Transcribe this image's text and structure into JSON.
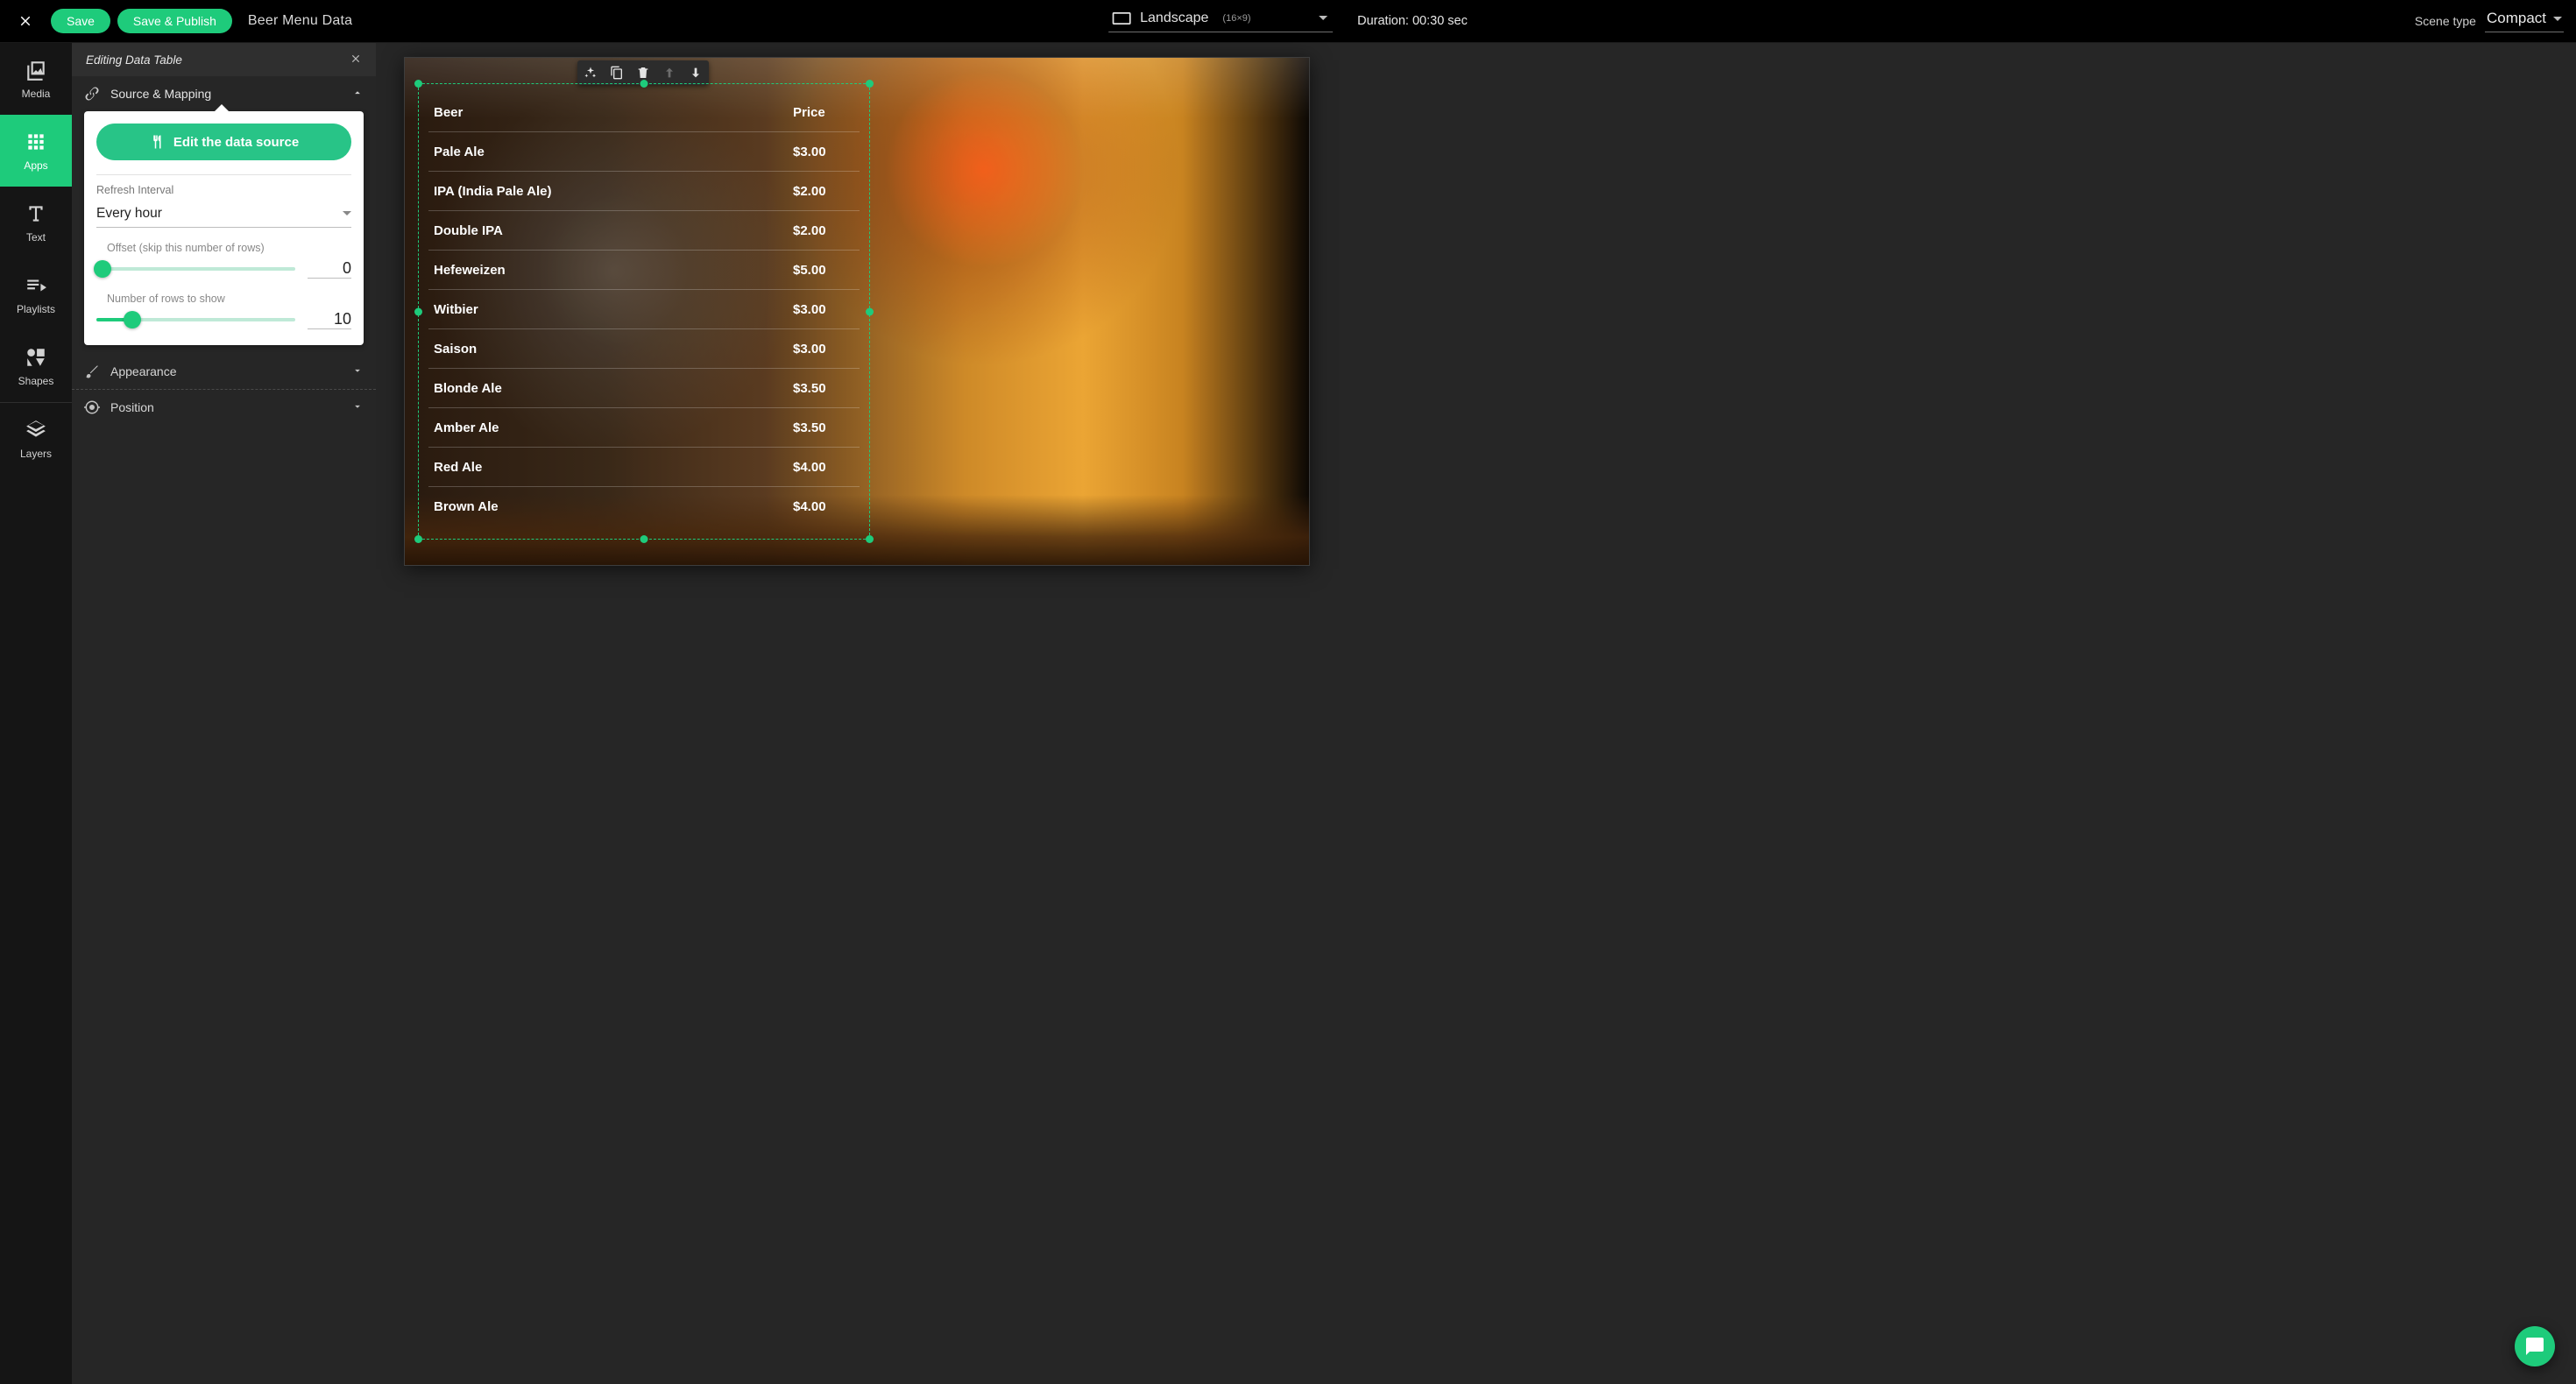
{
  "topbar": {
    "save": "Save",
    "save_publish": "Save & Publish",
    "title": "Beer Menu Data",
    "orientation": {
      "label": "Landscape",
      "dims": "(16×9)"
    },
    "duration_label": "Duration: 00:30 sec",
    "scene_type_label": "Scene type",
    "scene_type_value": "Compact"
  },
  "nav": {
    "media": "Media",
    "apps": "Apps",
    "text": "Text",
    "playlists": "Playlists",
    "shapes": "Shapes",
    "layers": "Layers"
  },
  "panel": {
    "title": "Editing Data Table",
    "source_mapping": "Source & Mapping",
    "edit_source": "Edit the data source",
    "refresh_label": "Refresh Interval",
    "refresh_value": "Every hour",
    "offset_label": "Offset (skip this number of rows)",
    "offset_value": "0",
    "rows_label": "Number of rows to show",
    "rows_value": "10",
    "appearance": "Appearance",
    "position": "Position"
  },
  "table": {
    "headers": {
      "col1": "Beer",
      "col2": "Price"
    },
    "rows": [
      {
        "name": "Pale Ale",
        "price": "$3.00"
      },
      {
        "name": "IPA (India Pale Ale)",
        "price": "$2.00"
      },
      {
        "name": "Double IPA",
        "price": "$2.00"
      },
      {
        "name": "Hefeweizen",
        "price": "$5.00"
      },
      {
        "name": "Witbier",
        "price": "$3.00"
      },
      {
        "name": "Saison",
        "price": "$3.00"
      },
      {
        "name": "Blonde Ale",
        "price": "$3.50"
      },
      {
        "name": "Amber Ale",
        "price": "$3.50"
      },
      {
        "name": "Red Ale",
        "price": "$4.00"
      },
      {
        "name": "Brown Ale",
        "price": "$4.00"
      }
    ]
  },
  "colors": {
    "accent": "#1ecb7b"
  }
}
